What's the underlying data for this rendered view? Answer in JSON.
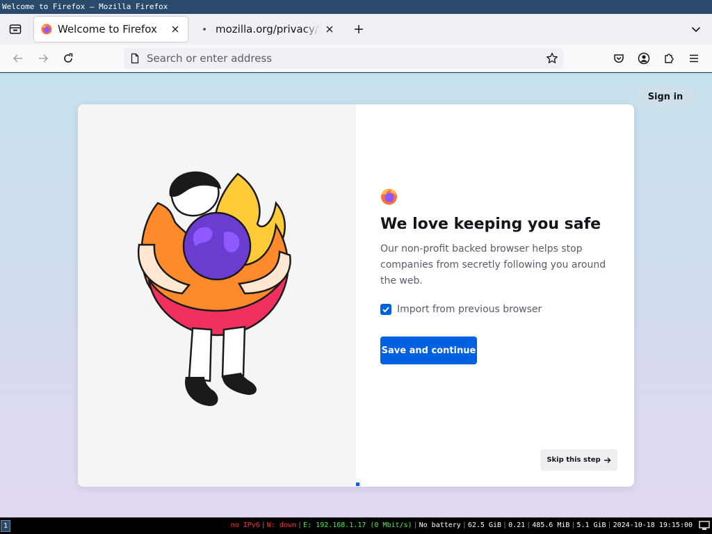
{
  "window": {
    "title": "Welcome to Firefox — Mozilla Firefox"
  },
  "tabs": [
    {
      "label": "Welcome to Firefox",
      "active": true,
      "icon": "firefox-icon"
    },
    {
      "label": "mozilla.org/privacy/firefox/",
      "active": false,
      "icon": "loading-dot-icon"
    }
  ],
  "urlbar": {
    "placeholder": "Search or enter address"
  },
  "page": {
    "signin_label": "Sign in",
    "heading": "We love keeping you safe",
    "description": "Our non-profit backed browser helps stop companies from secretly following you around the web.",
    "import_checkbox": {
      "label": "Import from previous browser",
      "checked": true
    },
    "primary_button": "Save and continue",
    "skip_button": "Skip this step",
    "accent_color": "#0061e0"
  },
  "statusbar": {
    "workspace": "1",
    "items": [
      {
        "text": "no IPv6",
        "color": "#ff3030"
      },
      {
        "text": "W: down",
        "color": "#ff3030"
      },
      {
        "text": "E: 192.168.1.17 (0 Mbit/s)",
        "color": "#30ff30"
      },
      {
        "text": "No battery",
        "color": "#ffffff"
      },
      {
        "text": "62.5 GiB",
        "color": "#ffffff"
      },
      {
        "text": "0.21",
        "color": "#ffffff"
      },
      {
        "text": "485.6 MiB",
        "color": "#ffffff"
      },
      {
        "text": "5.1 GiB",
        "color": "#ffffff"
      },
      {
        "text": "2024-10-18 19:15:00",
        "color": "#ffffff"
      }
    ]
  }
}
